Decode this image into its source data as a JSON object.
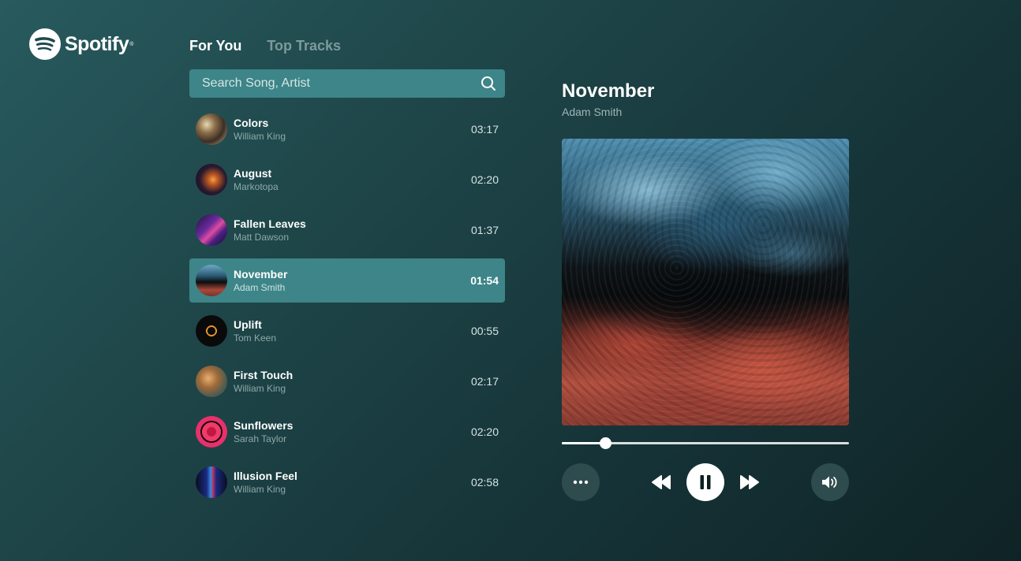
{
  "brand": {
    "name": "Spotify",
    "reg": "®",
    "logo_icon": "spotify-logo-icon"
  },
  "tabs": [
    {
      "label": "For You",
      "active": true
    },
    {
      "label": "Top Tracks",
      "active": false
    }
  ],
  "search": {
    "placeholder": "Search Song, Artist",
    "value": "",
    "icon": "search-icon"
  },
  "tracks": [
    {
      "title": "Colors",
      "artist": "William King",
      "duration": "03:17",
      "selected": false
    },
    {
      "title": "August",
      "artist": "Markotopa",
      "duration": "02:20",
      "selected": false
    },
    {
      "title": "Fallen Leaves",
      "artist": "Matt Dawson",
      "duration": "01:37",
      "selected": false
    },
    {
      "title": "November",
      "artist": "Adam Smith",
      "duration": "01:54",
      "selected": true
    },
    {
      "title": "Uplift",
      "artist": "Tom Keen",
      "duration": "00:55",
      "selected": false
    },
    {
      "title": "First Touch",
      "artist": "William King",
      "duration": "02:17",
      "selected": false
    },
    {
      "title": "Sunflowers",
      "artist": "Sarah Taylor",
      "duration": "02:20",
      "selected": false
    },
    {
      "title": "Illusion Feel",
      "artist": "William King",
      "duration": "02:58",
      "selected": false
    }
  ],
  "player": {
    "title": "November",
    "artist": "Adam Smith",
    "progress_fraction": 0.15,
    "controls": [
      "more-icon",
      "rewind-icon",
      "pause-icon",
      "fast-forward-icon",
      "volume-icon"
    ]
  },
  "colors": {
    "accent": "#3d8588",
    "background": "#1e4548",
    "muted_text": "#8fa9aa",
    "control_bg": "#2e4b4d"
  }
}
